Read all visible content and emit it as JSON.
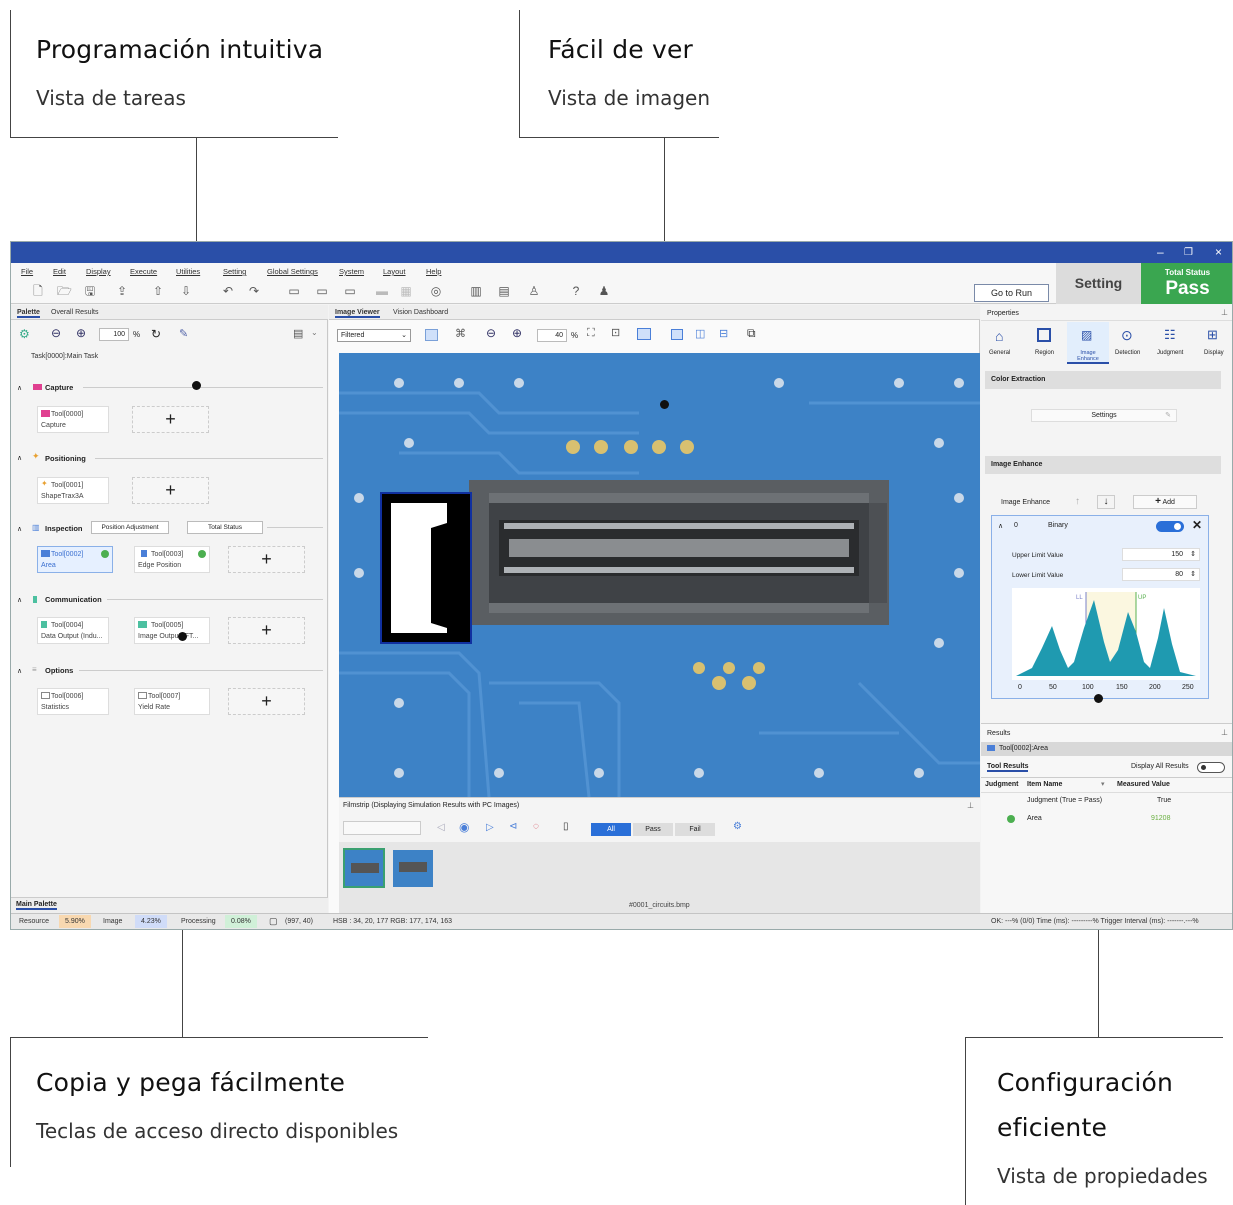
{
  "callouts": {
    "c1": {
      "title": "Programación intuitiva",
      "sub": "Vista de tareas"
    },
    "c2": {
      "title": "Fácil de ver",
      "sub": "Vista de imagen"
    },
    "c3": {
      "title": "Copia y pega fácilmente",
      "sub": "Teclas de acceso directo disponibles"
    },
    "c4": {
      "title1": "Configuración",
      "title2": "eficiente",
      "sub": "Vista de propiedades"
    }
  },
  "window": {
    "minimize": "–",
    "restore": "❐",
    "close": "×"
  },
  "menu": [
    "File",
    "Edit",
    "Display",
    "Execute",
    "Utilities",
    "Setting",
    "Global Settings",
    "System",
    "Layout",
    "Help"
  ],
  "toolbar": {
    "go_to_run": "Go to Run",
    "setting": "Setting",
    "total_status_label": "Total Status",
    "total_status_value": "Pass"
  },
  "palette": {
    "tabs": [
      "Palette",
      "Overall Results"
    ],
    "zoom": "100",
    "percent": "%",
    "task": "Task[0000]:Main Task",
    "sections": [
      "Capture",
      "Positioning",
      "Inspection",
      "Communication",
      "Options"
    ],
    "inspection_buttons": [
      "Position Adjustment",
      "Total Status"
    ],
    "tools": [
      {
        "id": "Tool[0000]",
        "name": "Capture"
      },
      {
        "id": "Tool[0001]",
        "name": "ShapeTrax3A"
      },
      {
        "id": "Tool[0002]",
        "name": "Area"
      },
      {
        "id": "Tool[0003]",
        "name": "Edge Position"
      },
      {
        "id": "Tool[0004]",
        "name": "Data Output (Indu..."
      },
      {
        "id": "Tool[0005]",
        "name": "Image Output (FT..."
      },
      {
        "id": "Tool[0006]",
        "name": "Statistics"
      },
      {
        "id": "Tool[0007]",
        "name": "Yield Rate"
      }
    ],
    "plus": "+",
    "bottom_tab": "Main Palette"
  },
  "viewer": {
    "tabs": [
      "Image Viewer",
      "Vision Dashboard"
    ],
    "mode": "Filtered",
    "zoom": "40",
    "percent": "%",
    "filmstrip_title": "Filmstrip (Displaying Simulation Results with PC Images)",
    "filter_buttons": [
      "All",
      "Pass",
      "Fail"
    ],
    "filename": "#0001_circuits.bmp"
  },
  "props": {
    "title": "Properties",
    "tabs": [
      "General",
      "Region",
      "Image Enhance",
      "Detection",
      "Judgment",
      "Display"
    ],
    "color_extraction": "Color Extraction",
    "settings": "Settings",
    "image_enhance_header": "Image Enhance",
    "image_enhance_label": "Image Enhance",
    "add": "Add",
    "item_index": "0",
    "item_name": "Binary",
    "upper_label": "Upper Limit Value",
    "upper_value": "150",
    "lower_label": "Lower Limit Value",
    "lower_value": "80",
    "hist_ticks": [
      "0",
      "50",
      "100",
      "150",
      "200",
      "250"
    ],
    "hist_marks": [
      "LL",
      "UP"
    ]
  },
  "results": {
    "title": "Results",
    "tool": "Tool[0002]:Area",
    "tab": "Tool Results",
    "display_all": "Display All Results",
    "headers": [
      "Judgment",
      "Item Name",
      "Measured Value"
    ],
    "rows": [
      {
        "name": "Judgment (True = Pass)",
        "value": "True"
      },
      {
        "name": "Area",
        "value": "91208"
      }
    ]
  },
  "statusbar": {
    "resource_label": "Resource",
    "resource_value": "5.90%",
    "image_label": "Image",
    "image_value": "4.23%",
    "processing_label": "Processing",
    "processing_value": "0.08%",
    "coords": "(997, 40)",
    "hsb": "HSB : 34, 20, 177 RGB: 177, 174, 163",
    "right": "OK: ---% (0/0) Time (ms): ---------% Trigger Interval (ms): -------.---%"
  },
  "colors": {
    "accent": "#2a4fa8",
    "pass": "#3aa650",
    "board": "#3b7fc4"
  }
}
